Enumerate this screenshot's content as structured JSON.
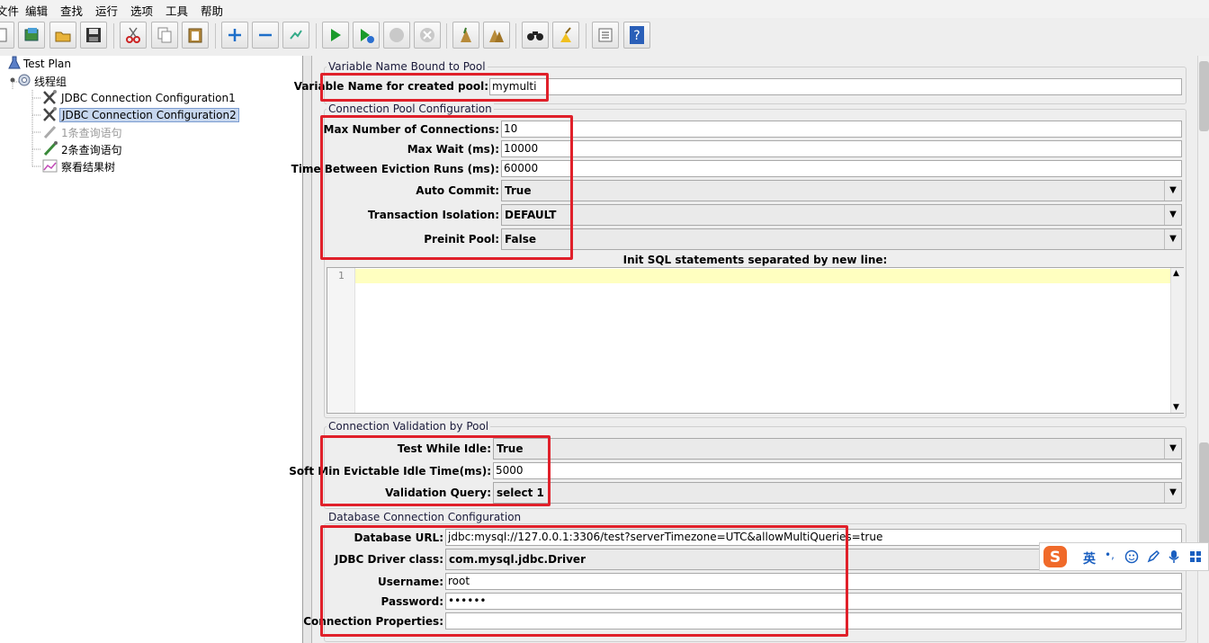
{
  "menu": [
    "文件",
    "编辑",
    "查找",
    "运行",
    "选项",
    "工具",
    "帮助"
  ],
  "tree": {
    "root": "Test Plan",
    "group": "线程组",
    "items": [
      {
        "label": "JDBC Connection Configuration1",
        "selected": false,
        "disabled": false
      },
      {
        "label": "JDBC Connection Configuration2",
        "selected": true,
        "disabled": false
      },
      {
        "label": "1条查询语句",
        "selected": false,
        "disabled": true
      },
      {
        "label": "2条查询语句",
        "selected": false,
        "disabled": false
      },
      {
        "label": "察看结果树",
        "selected": false,
        "disabled": false
      }
    ]
  },
  "pool_binding": {
    "legend": "Variable Name Bound to Pool",
    "label": "Variable Name for created pool:",
    "value": "mymulti"
  },
  "pool_config": {
    "legend": "Connection Pool Configuration",
    "max_connections": {
      "label": "Max Number of Connections:",
      "value": "10"
    },
    "max_wait": {
      "label": "Max Wait (ms):",
      "value": "10000"
    },
    "eviction": {
      "label": "Time Between Eviction Runs (ms):",
      "value": "60000"
    },
    "auto_commit": {
      "label": "Auto Commit:",
      "value": "True"
    },
    "isolation": {
      "label": "Transaction Isolation:",
      "value": "DEFAULT"
    },
    "preinit": {
      "label": "Preinit Pool:",
      "value": "False"
    },
    "init_sql_label": "Init SQL statements separated by new line:",
    "line_number": "1"
  },
  "validation": {
    "legend": "Connection Validation by Pool",
    "test_while_idle": {
      "label": "Test While Idle:",
      "value": "True"
    },
    "soft_min": {
      "label": "Soft Min Evictable Idle Time(ms):",
      "value": "5000"
    },
    "query": {
      "label": "Validation Query:",
      "value": "select 1"
    }
  },
  "database": {
    "legend": "Database Connection Configuration",
    "url": {
      "label": "Database URL:",
      "value": "jdbc:mysql://127.0.0.1:3306/test?serverTimezone=UTC&allowMultiQueries=true"
    },
    "driver": {
      "label": "JDBC Driver class:",
      "value": "com.mysql.jdbc.Driver"
    },
    "username": {
      "label": "Username:",
      "value": "root"
    },
    "password": {
      "label": "Password:",
      "value": "••••••"
    },
    "properties": {
      "label": "Connection Properties:",
      "value": ""
    }
  },
  "ime": {
    "lang": "英",
    "punct": "•,"
  },
  "colors": {
    "highlight": "#e0202a",
    "selection": "#c7d7ef",
    "sql_line": "#ffffc0"
  }
}
